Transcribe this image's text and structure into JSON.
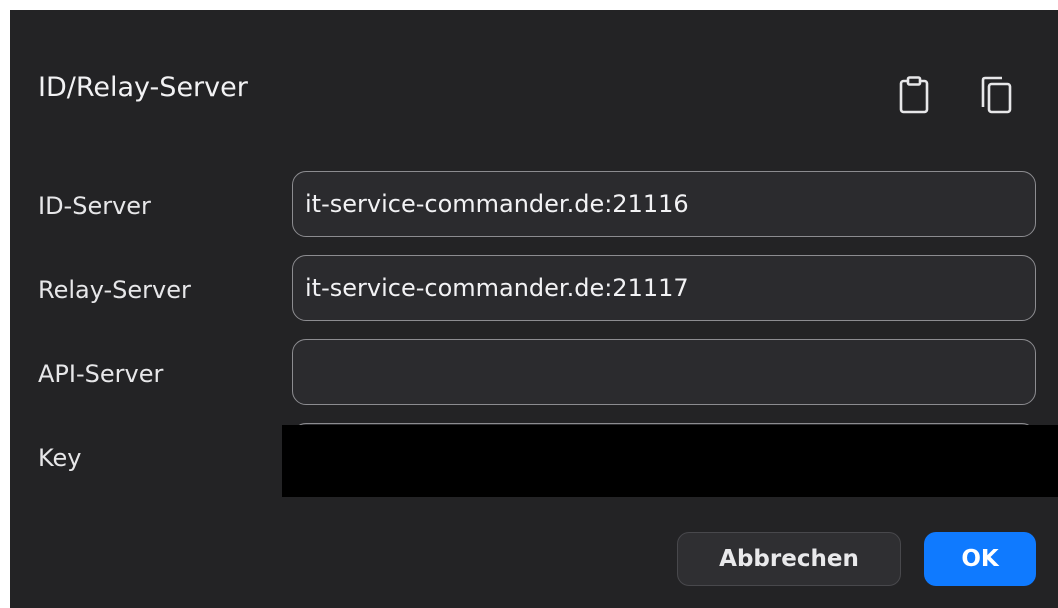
{
  "dialog": {
    "title": "ID/Relay-Server",
    "icons": {
      "paste": "clipboard-icon",
      "copy": "copy-icon"
    }
  },
  "fields": {
    "id_server": {
      "label": "ID-Server",
      "value": "it-service-commander.de:21116"
    },
    "relay_server": {
      "label": "Relay-Server",
      "value": "it-service-commander.de:21117"
    },
    "api_server": {
      "label": "API-Server",
      "value": ""
    },
    "key": {
      "label": "Key",
      "value": ""
    }
  },
  "buttons": {
    "cancel": "Abbrechen",
    "ok": "OK"
  },
  "colors": {
    "background": "#232325",
    "accent": "#0f7aff",
    "field_border": "#8c8c90",
    "text": "#e7e7e9"
  }
}
